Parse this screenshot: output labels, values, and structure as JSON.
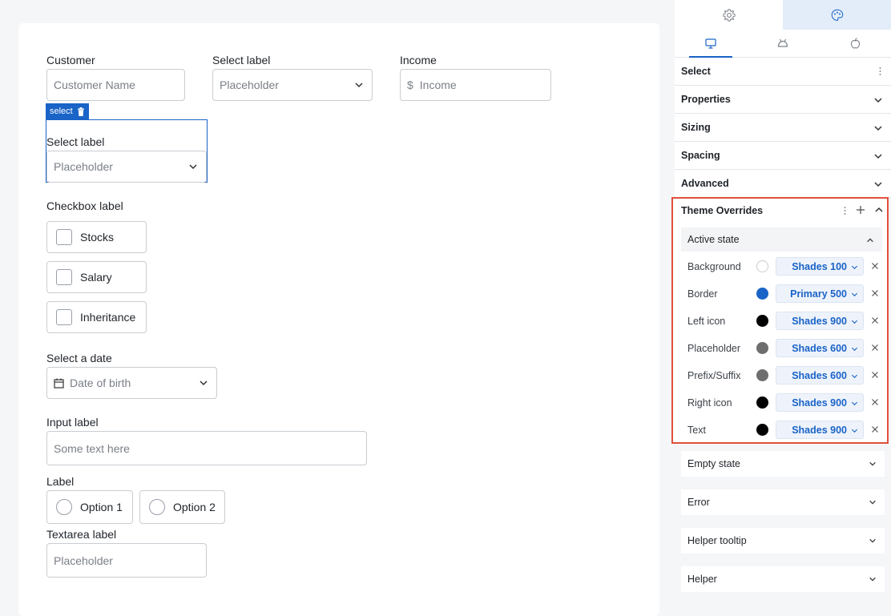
{
  "form": {
    "customer": {
      "label": "Customer",
      "placeholder": "Customer Name"
    },
    "select_top": {
      "label": "Select label",
      "placeholder": "Placeholder"
    },
    "income": {
      "label": "Income",
      "prefix": "$",
      "placeholder": "Income"
    },
    "selected_component": {
      "tag": "select",
      "label": "Select label",
      "placeholder": "Placeholder"
    },
    "checkbox": {
      "label": "Checkbox label",
      "options": [
        "Stocks",
        "Salary",
        "Inheritance"
      ]
    },
    "date": {
      "label": "Select a date",
      "placeholder": "Date of birth"
    },
    "input": {
      "label": "Input label",
      "placeholder": "Some text here"
    },
    "radio": {
      "label": "Label",
      "options": [
        "Option 1",
        "Option 2"
      ]
    },
    "textarea": {
      "label": "Textarea label",
      "placeholder": "Placeholder"
    }
  },
  "panel": {
    "top_tabs": [
      {
        "icon": "gear-icon"
      },
      {
        "icon": "palette-icon"
      }
    ],
    "device_tabs": [
      {
        "icon": "desktop-icon"
      },
      {
        "icon": "android-icon"
      },
      {
        "icon": "apple-icon"
      }
    ],
    "sections": [
      "Select",
      "Properties",
      "Sizing",
      "Spacing",
      "Advanced"
    ],
    "theme_overrides": {
      "title": "Theme Overrides",
      "active_state": "Active state",
      "rows": [
        {
          "name": "Background",
          "color": "#ffffff",
          "token": "Shades 100"
        },
        {
          "name": "Border",
          "color": "#1a63c7",
          "token": "Primary 500"
        },
        {
          "name": "Left icon",
          "color": "#000000",
          "token": "Shades 900"
        },
        {
          "name": "Placeholder",
          "color": "#6e6e6e",
          "token": "Shades 600"
        },
        {
          "name": "Prefix/Suffix",
          "color": "#6e6e6e",
          "token": "Shades 600"
        },
        {
          "name": "Right icon",
          "color": "#000000",
          "token": "Shades 900"
        },
        {
          "name": "Text",
          "color": "#000000",
          "token": "Shades 900"
        }
      ]
    },
    "sub_sections": [
      "Empty state",
      "Error",
      "Helper tooltip",
      "Helper"
    ]
  },
  "colors": {
    "accent": "#1a63c7",
    "highlight": "#e0503a"
  }
}
